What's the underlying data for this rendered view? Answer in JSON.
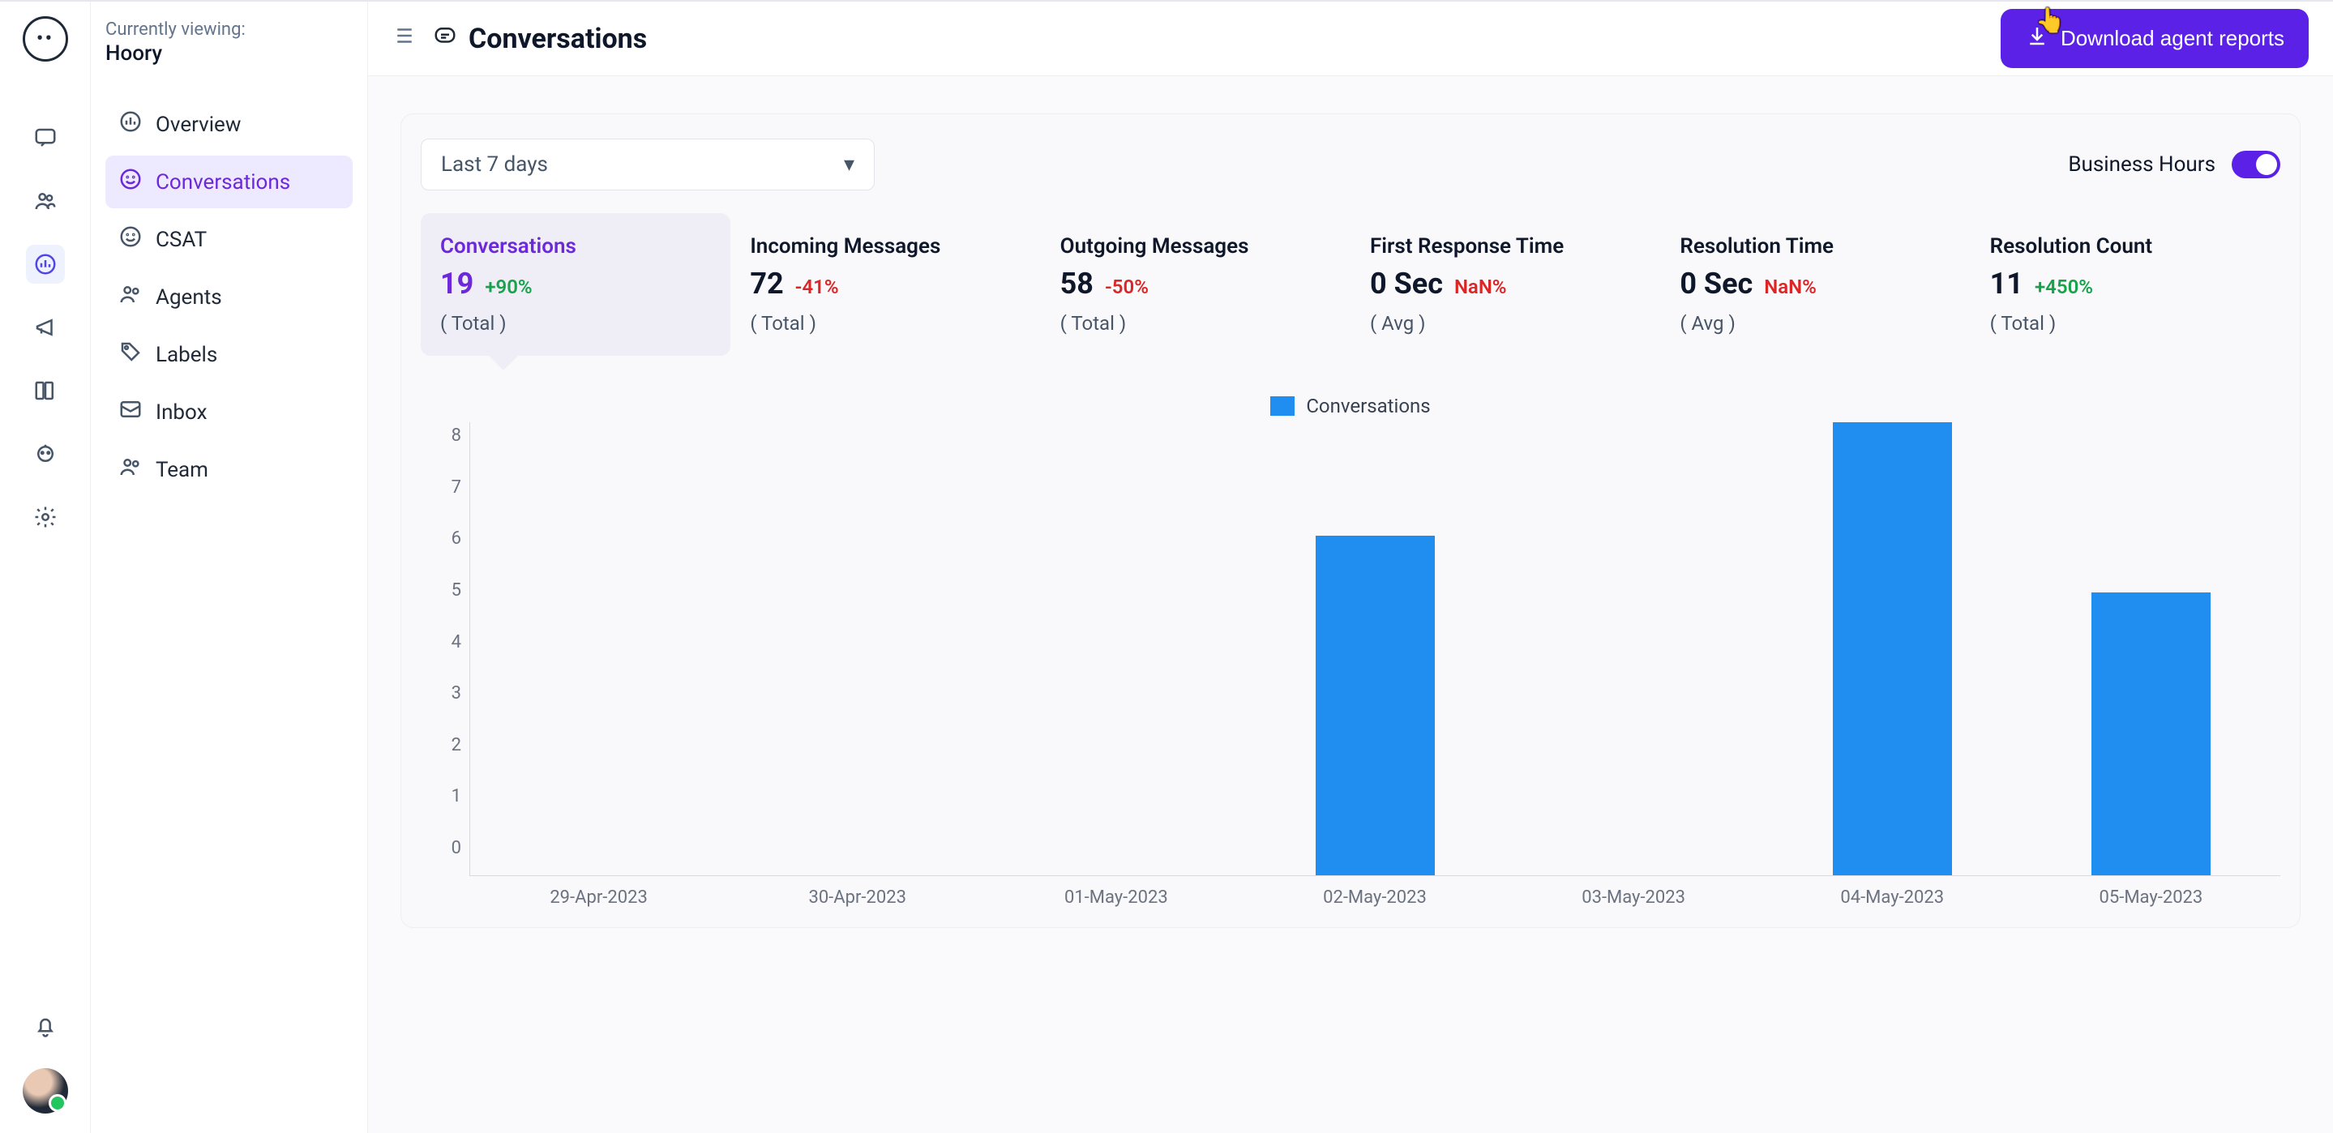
{
  "viewing": {
    "label": "Currently viewing:",
    "name": "Hoory"
  },
  "rail": {
    "notifications_icon": "bell-icon"
  },
  "nav": {
    "items": [
      {
        "key": "overview",
        "label": "Overview",
        "icon": "⦿"
      },
      {
        "key": "conversations",
        "label": "Conversations",
        "icon": "☺",
        "selected": true
      },
      {
        "key": "csat",
        "label": "CSAT",
        "icon": "☺"
      },
      {
        "key": "agents",
        "label": "Agents",
        "icon": "👥"
      },
      {
        "key": "labels",
        "label": "Labels",
        "icon": "🏷"
      },
      {
        "key": "inbox",
        "label": "Inbox",
        "icon": "✉"
      },
      {
        "key": "team",
        "label": "Team",
        "icon": "👥"
      }
    ]
  },
  "header": {
    "title": "Conversations",
    "download_label": "Download agent reports"
  },
  "filters": {
    "range": "Last 7 days",
    "business_hours_label": "Business Hours",
    "business_hours_on": true
  },
  "tiles": [
    {
      "title": "Conversations",
      "value": "19",
      "change": "+90%",
      "change_class": "green",
      "sub": "( Total )",
      "selected": true
    },
    {
      "title": "Incoming Messages",
      "value": "72",
      "change": "-41%",
      "change_class": "red",
      "sub": "( Total )"
    },
    {
      "title": "Outgoing Messages",
      "value": "58",
      "change": "-50%",
      "change_class": "red",
      "sub": "( Total )"
    },
    {
      "title": "First Response Time",
      "value": "0 Sec",
      "change": "NaN%",
      "change_class": "red",
      "sub": "( Avg )"
    },
    {
      "title": "Resolution Time",
      "value": "0 Sec",
      "change": "NaN%",
      "change_class": "red",
      "sub": "( Avg )"
    },
    {
      "title": "Resolution Count",
      "value": "11",
      "change": "+450%",
      "change_class": "green",
      "sub": "( Total )"
    }
  ],
  "chart_data": {
    "type": "bar",
    "title": "",
    "legend": "Conversations",
    "categories": [
      "29-Apr-2023",
      "30-Apr-2023",
      "01-May-2023",
      "02-May-2023",
      "03-May-2023",
      "04-May-2023",
      "05-May-2023"
    ],
    "values": [
      0,
      0,
      0,
      6,
      0,
      8,
      5
    ],
    "ylim": [
      0,
      8
    ],
    "yticks": [
      0,
      1,
      2,
      3,
      4,
      5,
      6,
      7,
      8
    ],
    "xlabel": "",
    "ylabel": ""
  }
}
